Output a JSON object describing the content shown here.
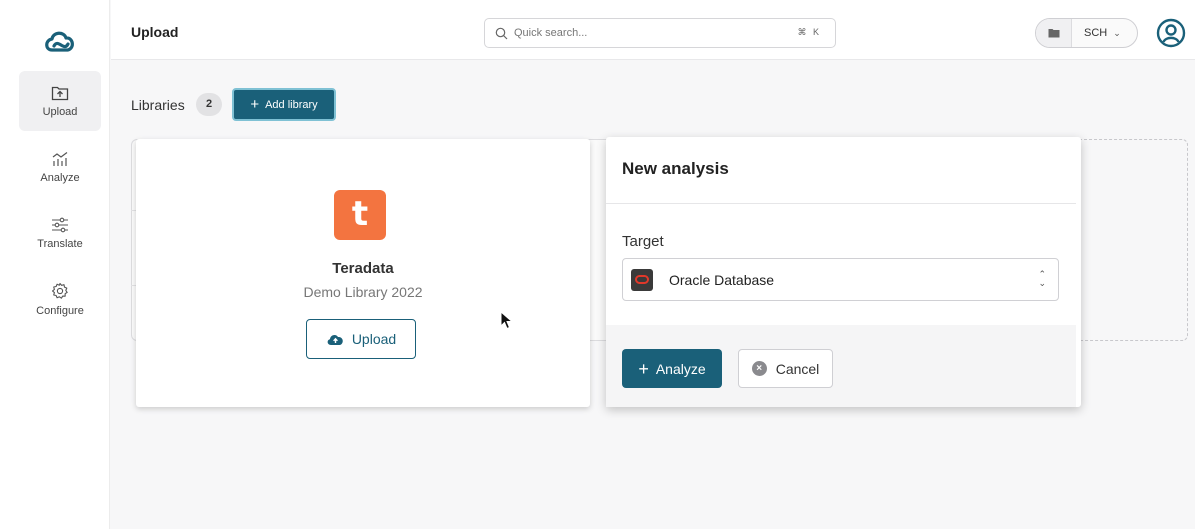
{
  "sidebar": {
    "items": [
      {
        "label": "Upload",
        "icon": "upload-folder-icon",
        "active": true
      },
      {
        "label": "Analyze",
        "icon": "chart-icon",
        "active": false
      },
      {
        "label": "Translate",
        "icon": "sliders-icon",
        "active": false
      },
      {
        "label": "Configure",
        "icon": "gear-icon",
        "active": false
      }
    ]
  },
  "topbar": {
    "title": "Upload",
    "search_placeholder": "Quick search...",
    "search_shortcut": "⌘ K",
    "schema": "SCH"
  },
  "libraries": {
    "title": "Libraries",
    "count": "2",
    "add_label": "Add library"
  },
  "library_card": {
    "logo_letter": "t",
    "name": "Teradata",
    "description": "Demo Library 2022",
    "upload_label": "Upload"
  },
  "dialog": {
    "title": "New analysis",
    "target_label": "Target",
    "target_value": "Oracle Database",
    "analyze_label": "Analyze",
    "cancel_label": "Cancel"
  },
  "colors": {
    "primary": "#1a6079",
    "teradata_orange": "#f37440",
    "oracle_red": "#e0382a"
  }
}
